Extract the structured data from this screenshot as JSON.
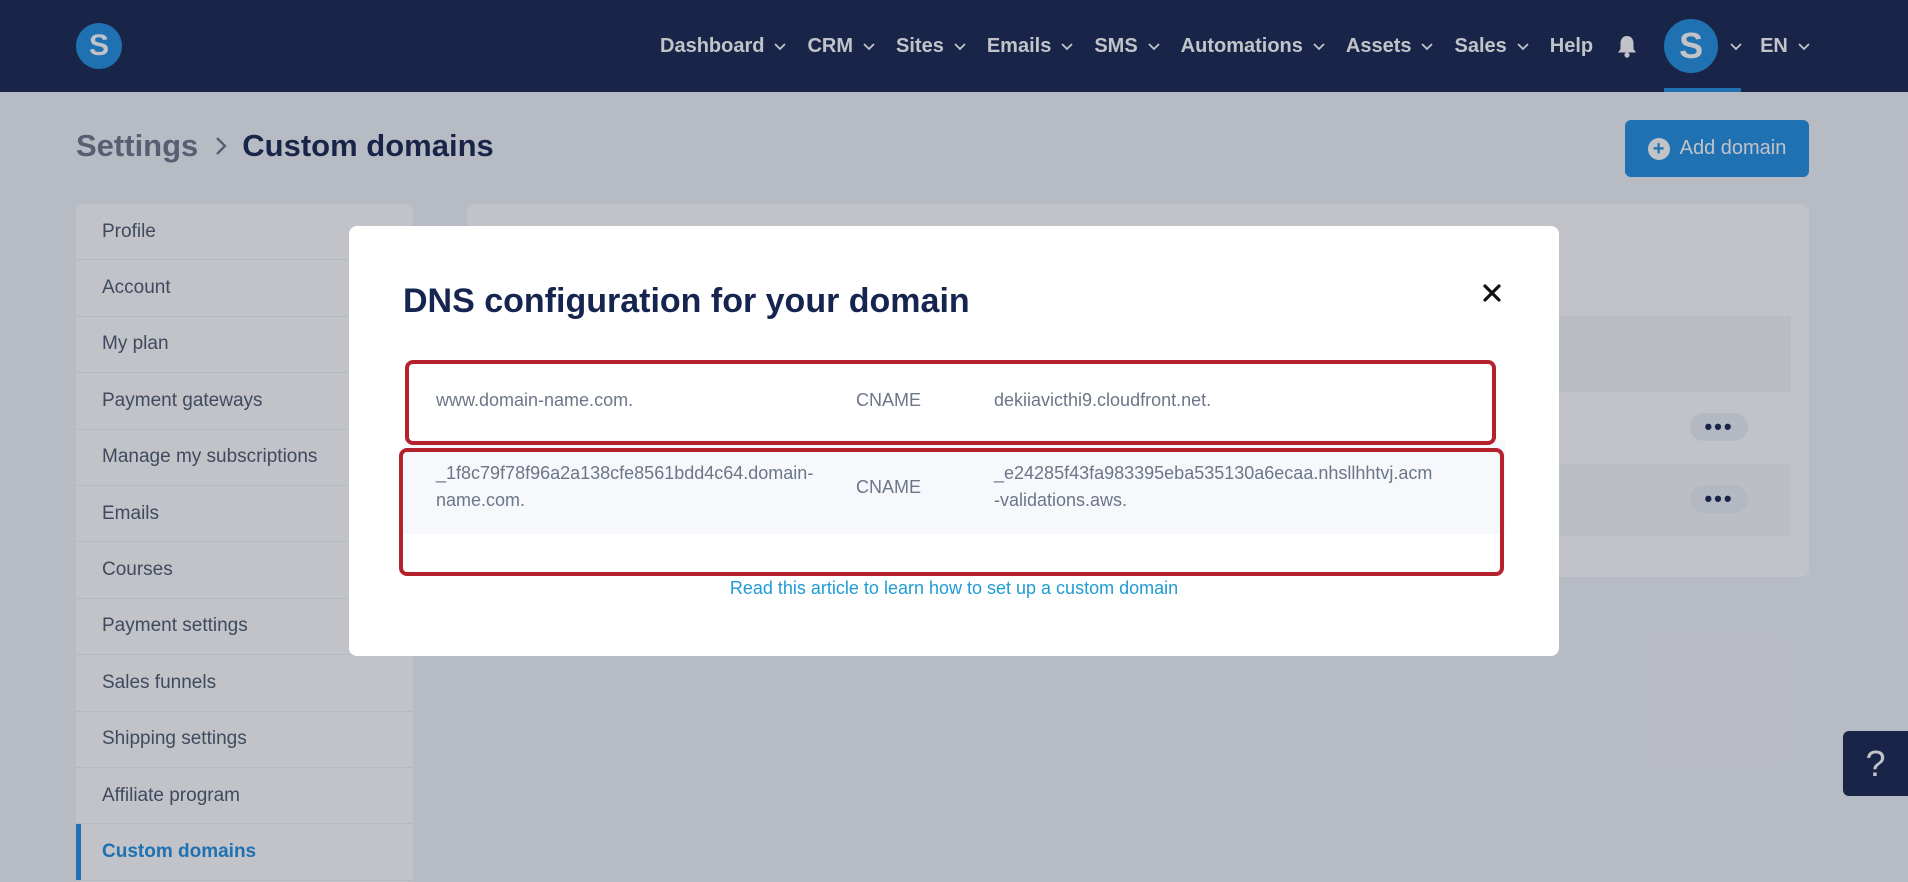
{
  "app": {
    "logo_letter": "S",
    "brand_color": "#1f8ee0",
    "navbar_color": "#16254f"
  },
  "nav": {
    "items": [
      {
        "label": "Dashboard",
        "has_dropdown": true
      },
      {
        "label": "CRM",
        "has_dropdown": true
      },
      {
        "label": "Sites",
        "has_dropdown": true
      },
      {
        "label": "Emails",
        "has_dropdown": true
      },
      {
        "label": "SMS",
        "has_dropdown": true
      },
      {
        "label": "Automations",
        "has_dropdown": true
      },
      {
        "label": "Assets",
        "has_dropdown": true
      },
      {
        "label": "Sales",
        "has_dropdown": true
      },
      {
        "label": "Help",
        "has_dropdown": false
      }
    ],
    "notification_icon": "bell-icon",
    "avatar_letter": "S",
    "language": "EN"
  },
  "header": {
    "breadcrumb_parent": "Settings",
    "breadcrumb_current": "Custom domains",
    "add_button_label": "Add domain"
  },
  "sidebar": {
    "items": [
      {
        "label": "Profile",
        "active": false
      },
      {
        "label": "Account",
        "active": false
      },
      {
        "label": "My plan",
        "active": false
      },
      {
        "label": "Payment gateways",
        "active": false
      },
      {
        "label": "Manage my subscriptions",
        "active": false
      },
      {
        "label": "Emails",
        "active": false
      },
      {
        "label": "Courses",
        "active": false
      },
      {
        "label": "Payment settings",
        "active": false
      },
      {
        "label": "Sales funnels",
        "active": false
      },
      {
        "label": "Shipping settings",
        "active": false
      },
      {
        "label": "Affiliate program",
        "active": false
      },
      {
        "label": "Custom domains",
        "active": true
      }
    ]
  },
  "content": {
    "row_actions_label": "•••"
  },
  "modal": {
    "title": "DNS configuration for your domain",
    "records": [
      {
        "host": "www.domain-name.com.",
        "type": "CNAME",
        "value": "dekiiavicthi9.cloudfront.net."
      },
      {
        "host": "_1f8c79f78f96a2a138cfe8561bdd4c64.domain-name.com.",
        "type": "CNAME",
        "value": "_e24285f43fa983395eba535130a6ecaa.nhsllhhtvj.acm-validations.aws."
      }
    ],
    "link_text": "Read this article to learn how to set up a custom domain",
    "highlight_color": "#b5222d"
  },
  "help_widget": {
    "label": "?"
  }
}
